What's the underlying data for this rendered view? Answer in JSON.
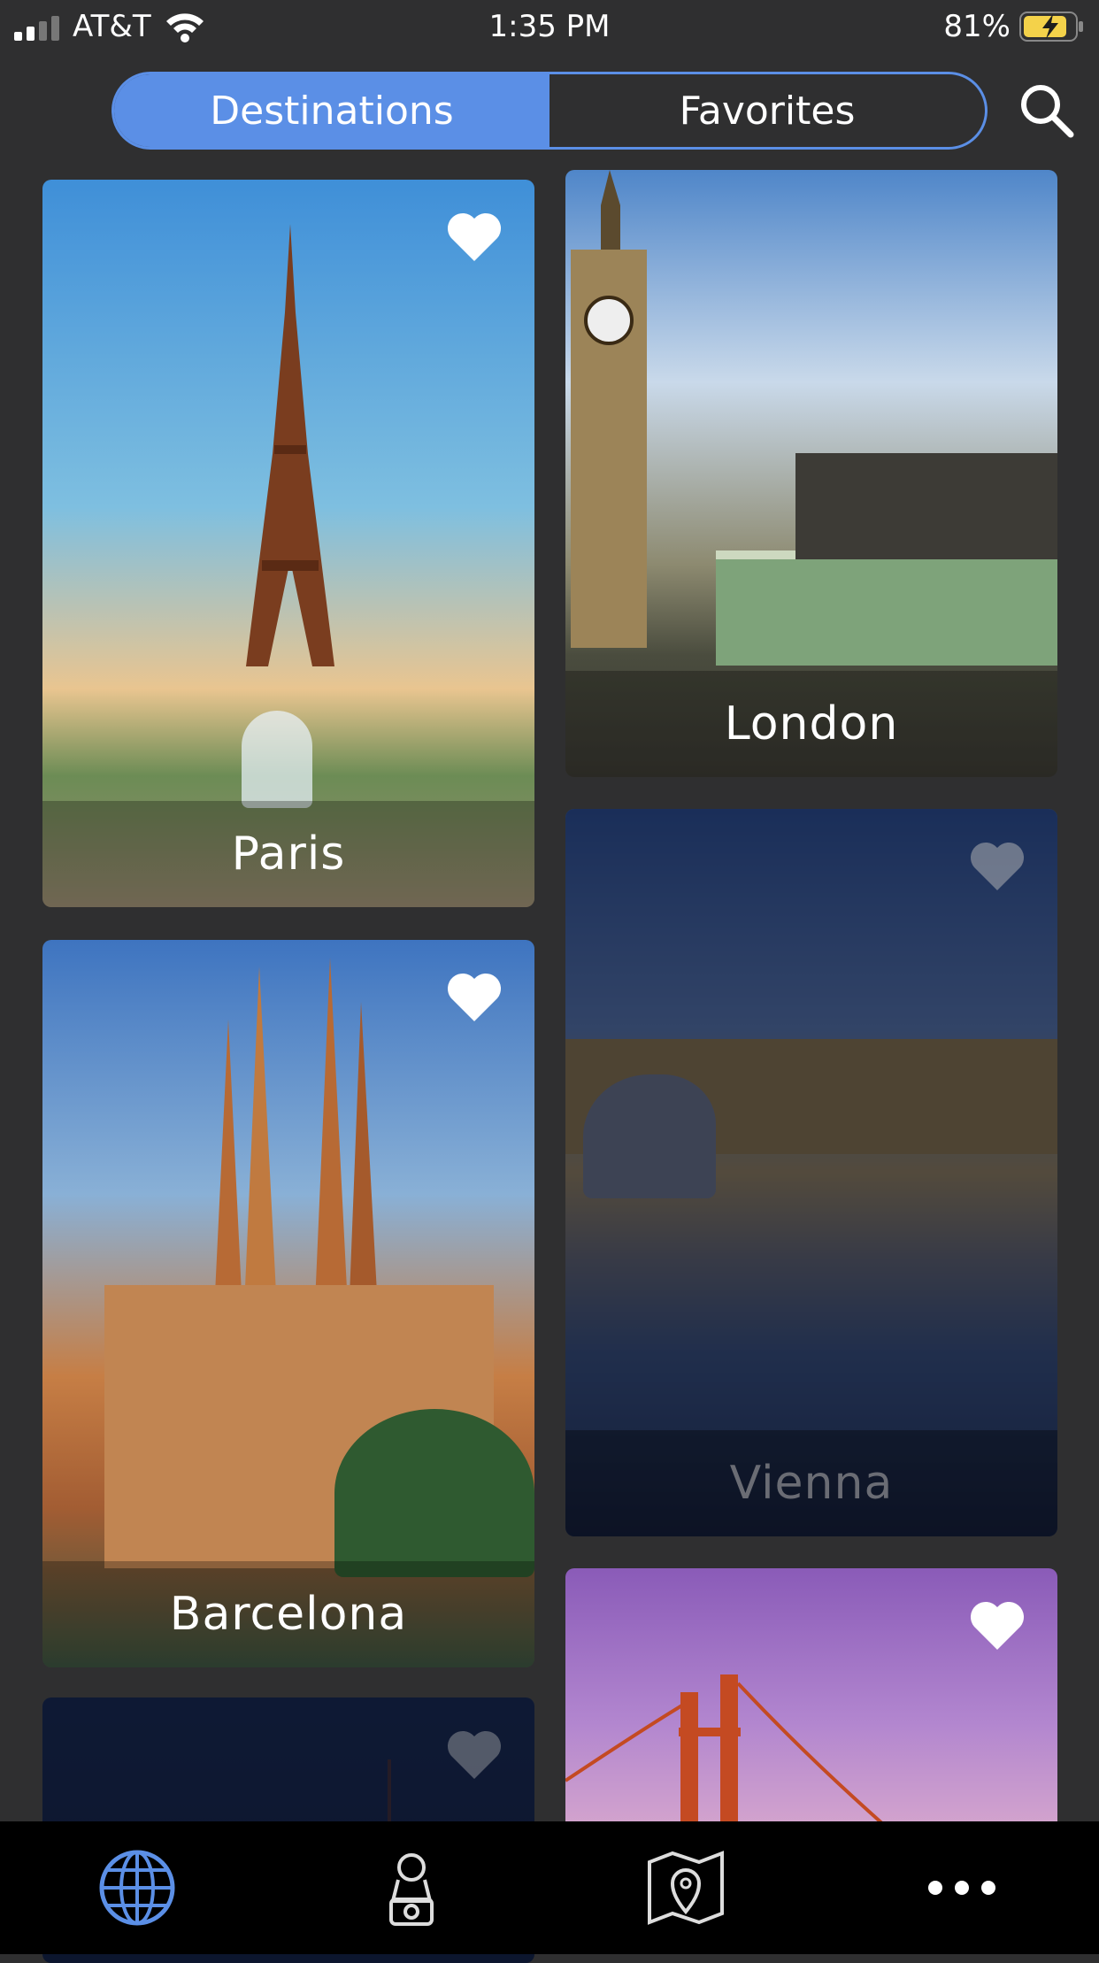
{
  "status_bar": {
    "carrier": "AT&T",
    "time": "1:35 PM",
    "battery": "81%"
  },
  "segmented": {
    "tabs": [
      "Destinations",
      "Favorites"
    ],
    "active": "Destinations"
  },
  "accent_color": "#5b8fe6",
  "cards": [
    {
      "name": "Paris",
      "favorite": true,
      "dimmed": false
    },
    {
      "name": "London",
      "favorite": false,
      "dimmed": false
    },
    {
      "name": "Barcelona",
      "favorite": true,
      "dimmed": false
    },
    {
      "name": "Vienna",
      "favorite": true,
      "dimmed": true
    },
    {
      "name": "",
      "favorite": true,
      "dimmed": false
    },
    {
      "name": "",
      "favorite": true,
      "dimmed": true
    }
  ],
  "tab_bar": {
    "items": [
      "globe-icon",
      "traveler-icon",
      "map-pin-icon",
      "more-icon"
    ],
    "active": "globe-icon"
  }
}
